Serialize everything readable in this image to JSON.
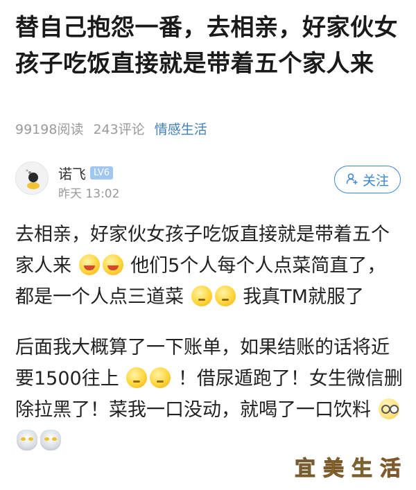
{
  "post": {
    "title": "替自己抱怨一番，去相亲，好家伙女孩子吃饭直接就是带着五个家人来",
    "reads": "99198阅读",
    "comments": "243评论",
    "topic": "情感生活"
  },
  "author": {
    "name": "诺飞",
    "level": "LV6",
    "time": "昨天 13:02",
    "follow_label": "关注"
  },
  "content": {
    "p1a": "去相亲，好家伙女孩子吃饭直接就是带着五个家人来",
    "p1b": "他们5个人每个人点菜简直了，都是一个人点三道菜",
    "p1c": "我真TM就服了",
    "p2a": "后面我大概算了一下账单，如果结账的话将近要1500往上",
    "p2b": "！借尿遁跑了！女生微信删除拉黑了！菜我一口没动，就喝了一口饮料"
  },
  "watermark": {
    "chars": [
      "宜",
      "美",
      "生",
      "活"
    ],
    "colors": [
      "#2f8fd6",
      "#e0a51c",
      "#6cbf3a",
      "#e04a6a"
    ]
  },
  "icons": {
    "follow": "add-user-icon",
    "emojis": [
      "laugh-emoji",
      "laugh-emoji",
      "think-emoji",
      "think-emoji",
      "think-emoji",
      "think-emoji",
      "glasses-emoji",
      "ultraman-emoji",
      "ultraman-emoji"
    ]
  },
  "colors": {
    "accent": "#3a86d6",
    "topic": "#3f7fbf",
    "meta": "#9a9a9a",
    "level_badge": "#9fc7f2"
  }
}
